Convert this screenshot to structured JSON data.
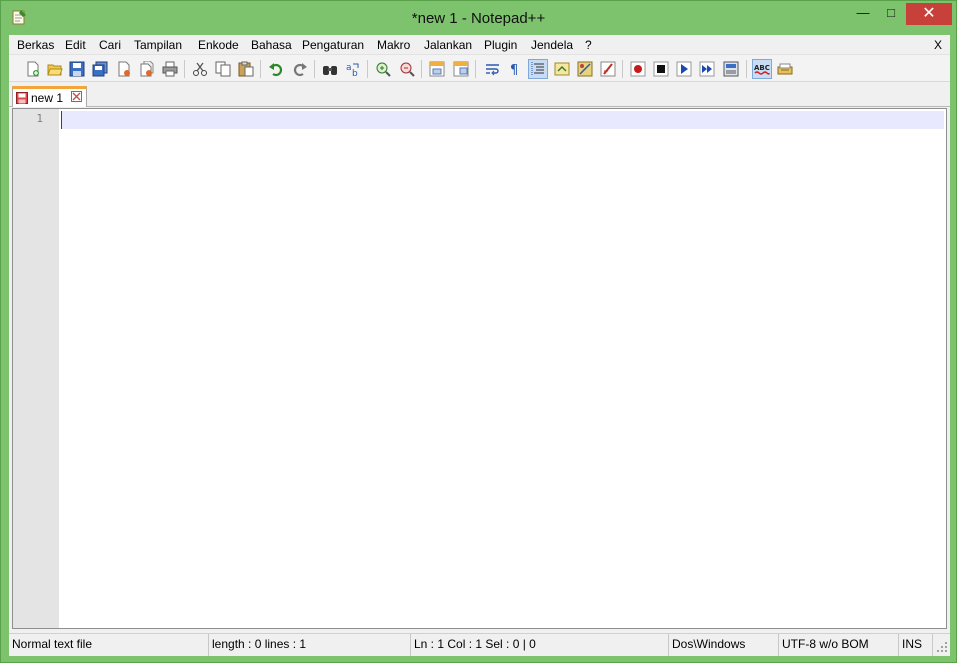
{
  "window": {
    "title": "*new  1 - Notepad++",
    "min_glyph": "—",
    "max_glyph": "□",
    "close_glyph": "✕"
  },
  "menu": {
    "items": [
      "Berkas",
      "Edit",
      "Cari",
      "Tampilan",
      "Enkode",
      "Bahasa",
      "Pengaturan",
      "Makro",
      "Jalankan",
      "Plugin",
      "Jendela",
      "?"
    ],
    "close_label": "X"
  },
  "toolbar": {
    "icons": [
      "new-file-icon",
      "open-file-icon",
      "save-icon",
      "save-all-icon",
      "close-icon",
      "close-all-icon",
      "print-icon",
      "cut-icon",
      "copy-icon",
      "paste-icon",
      "undo-icon",
      "redo-icon",
      "find-icon",
      "replace-icon",
      "zoom-in-icon",
      "zoom-out-icon",
      "sync-vertical-icon",
      "sync-horizontal-icon",
      "word-wrap-icon",
      "show-all-chars-icon",
      "indent-guide-icon",
      "user-lang-icon",
      "doc-map-icon",
      "function-list-icon",
      "record-macro-icon",
      "stop-macro-icon",
      "play-macro-icon",
      "run-macro-multiple-icon",
      "save-macro-icon",
      "spell-check-icon",
      "plugin-icon"
    ],
    "active": [
      "indent-guide-icon",
      "spell-check-icon"
    ]
  },
  "tabs": [
    {
      "label": "new  1",
      "modified": true
    }
  ],
  "editor": {
    "line_numbers": [
      "1"
    ],
    "content": ""
  },
  "status": {
    "file_type": "Normal text file",
    "length_lines": "length : 0    lines : 1",
    "position": "Ln : 1    Col : 1    Sel : 0 | 0",
    "eol": "Dos\\Windows",
    "encoding": "UTF-8 w/o BOM",
    "mode": "INS"
  },
  "colors": {
    "frame": "#7dc36e",
    "close_button": "#c7413a",
    "current_line": "#e8e8ff",
    "caret": "#8000ff",
    "tab_accent": "#f3a53a"
  }
}
